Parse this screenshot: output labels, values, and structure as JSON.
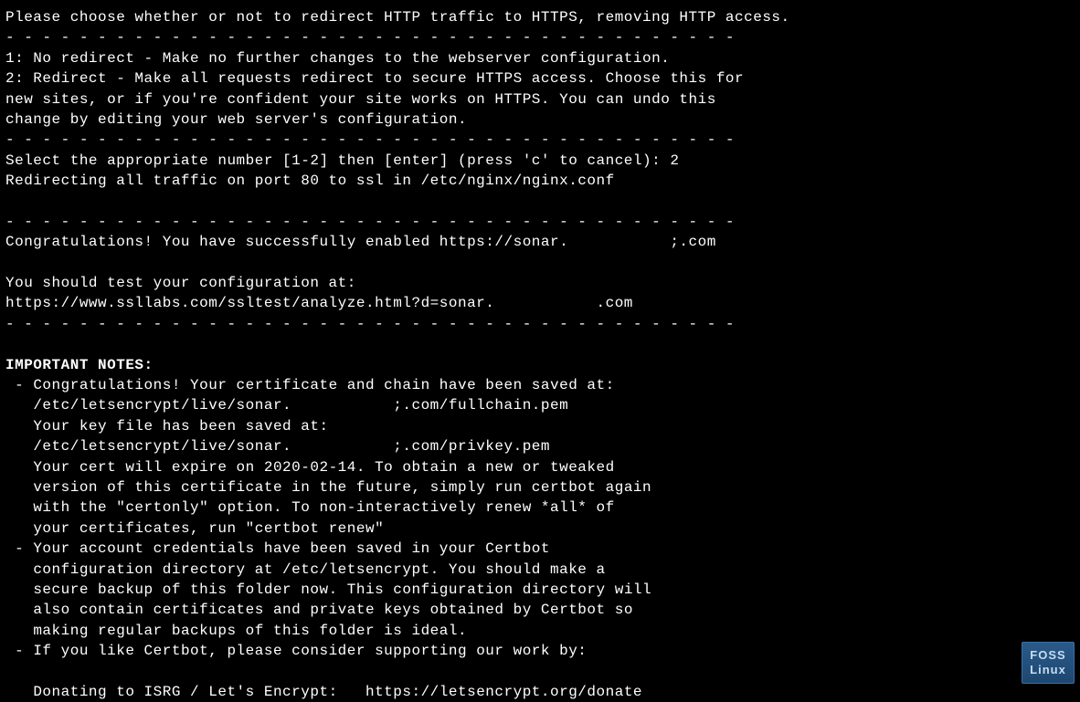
{
  "terminal": {
    "lines": [
      {
        "text": "Please choose whether or not to redirect HTTP traffic to HTTPS, removing HTTP access.",
        "bold": false
      },
      {
        "text": "- - - - - - - - - - - - - - - - - - - - - - - - - - - - - - - - - - - - - - - -",
        "bold": false
      },
      {
        "text": "1: No redirect - Make no further changes to the webserver configuration.",
        "bold": false
      },
      {
        "text": "2: Redirect - Make all requests redirect to secure HTTPS access. Choose this for",
        "bold": false
      },
      {
        "text": "new sites, or if you're confident your site works on HTTPS. You can undo this",
        "bold": false
      },
      {
        "text": "change by editing your web server's configuration.",
        "bold": false
      },
      {
        "text": "- - - - - - - - - - - - - - - - - - - - - - - - - - - - - - - - - - - - - - - -",
        "bold": false
      },
      {
        "text": "Select the appropriate number [1-2] then [enter] (press 'c' to cancel): 2",
        "bold": false
      },
      {
        "text": "Redirecting all traffic on port 80 to ssl in /etc/nginx/nginx.conf",
        "bold": false
      },
      {
        "text": "",
        "bold": false
      },
      {
        "text": "- - - - - - - - - - - - - - - - - - - - - - - - - - - - - - - - - - - - - - - -",
        "bold": false
      },
      {
        "text": "Congratulations! You have successfully enabled https://sonar.           ;.com",
        "bold": false
      },
      {
        "text": "",
        "bold": false
      },
      {
        "text": "You should test your configuration at:",
        "bold": false
      },
      {
        "text": "https://www.ssllabs.com/ssltest/analyze.html?d=sonar.           .com",
        "bold": false
      },
      {
        "text": "- - - - - - - - - - - - - - - - - - - - - - - - - - - - - - - - - - - - - - - -",
        "bold": false
      },
      {
        "text": "",
        "bold": false
      },
      {
        "text": "IMPORTANT NOTES:",
        "bold": true
      },
      {
        "text": " - Congratulations! Your certificate and chain have been saved at:",
        "bold": false
      },
      {
        "text": "   /etc/letsencrypt/live/sonar.           ;.com/fullchain.pem",
        "bold": false
      },
      {
        "text": "   Your key file has been saved at:",
        "bold": false
      },
      {
        "text": "   /etc/letsencrypt/live/sonar.           ;.com/privkey.pem",
        "bold": false
      },
      {
        "text": "   Your cert will expire on 2020-02-14. To obtain a new or tweaked",
        "bold": false
      },
      {
        "text": "   version of this certificate in the future, simply run certbot again",
        "bold": false
      },
      {
        "text": "   with the \"certonly\" option. To non-interactively renew *all* of",
        "bold": false
      },
      {
        "text": "   your certificates, run \"certbot renew\"",
        "bold": false
      },
      {
        "text": " - Your account credentials have been saved in your Certbot",
        "bold": false
      },
      {
        "text": "   configuration directory at /etc/letsencrypt. You should make a",
        "bold": false
      },
      {
        "text": "   secure backup of this folder now. This configuration directory will",
        "bold": false
      },
      {
        "text": "   also contain certificates and private keys obtained by Certbot so",
        "bold": false
      },
      {
        "text": "   making regular backups of this folder is ideal.",
        "bold": false
      },
      {
        "text": " - If you like Certbot, please consider supporting our work by:",
        "bold": false
      },
      {
        "text": "",
        "bold": false
      },
      {
        "text": "   Donating to ISRG / Let's Encrypt:   https://letsencrypt.org/donate",
        "bold": false
      }
    ]
  },
  "logo": {
    "line1": "FOSS",
    "line2": "Linux"
  }
}
